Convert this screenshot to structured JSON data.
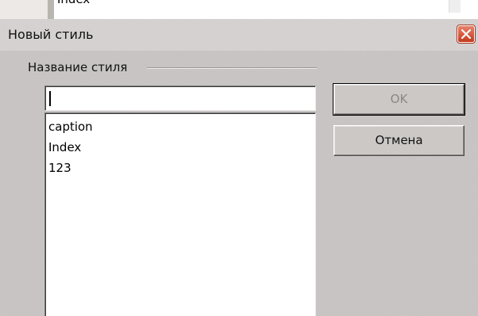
{
  "background_window": {
    "visible_text": "Index"
  },
  "dialog": {
    "title": "Новый стиль",
    "close_icon": "close-icon",
    "group_label": "Название стиля",
    "name_input": {
      "value": "",
      "placeholder": ""
    },
    "styles": [
      "caption",
      "Index",
      "123"
    ],
    "buttons": {
      "ok_label": "OK",
      "ok_enabled": false,
      "cancel_label": "Отмена"
    }
  },
  "colors": {
    "dialog_bg": "#c7c3c2",
    "close_button": "#c43a1c"
  }
}
